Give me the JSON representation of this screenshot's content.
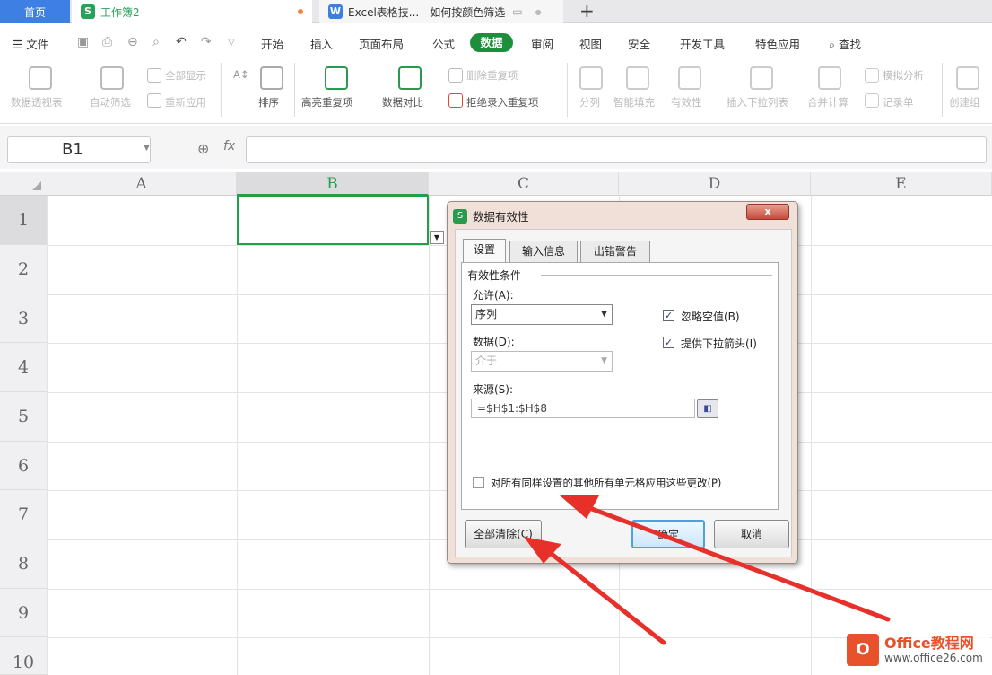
{
  "tabs": {
    "home": "首页",
    "workbook": "工作簿2",
    "doc": "Excel表格技...—如何按颜色筛选",
    "doc_icon": "W",
    "book_icon": "S",
    "new_tab": "+"
  },
  "menu": {
    "file": "文件",
    "items": [
      "开始",
      "插入",
      "页面布局",
      "公式",
      "数据",
      "审阅",
      "视图",
      "安全",
      "开发工具",
      "特色应用"
    ],
    "search": "查找"
  },
  "ribbon": {
    "pivot": "数据透视表",
    "autofilter": "自动筛选",
    "show_all": "全部显示",
    "reapply": "重新应用",
    "sort": "排序",
    "highlight_dup": "高亮重复项",
    "compare": "数据对比",
    "delete_dup": "删除重复项",
    "reject_dup": "拒绝录入重复项",
    "split": "分列",
    "fill": "智能填充",
    "validity": "有效性",
    "dropdown_list": "插入下拉列表",
    "consolidate": "合并计算",
    "simulation": "模拟分析",
    "record": "记录单",
    "create_group": "创建组"
  },
  "formula_bar": {
    "name_box": "B1",
    "fx": "fx",
    "value": ""
  },
  "sheet": {
    "columns": [
      "A",
      "B",
      "C",
      "D",
      "E"
    ],
    "rows": [
      "1",
      "2",
      "3",
      "4",
      "5",
      "6",
      "7",
      "8",
      "9",
      "10"
    ],
    "selected_cell": "B1",
    "accent": "#20a04a"
  },
  "dialog": {
    "title": "数据有效性",
    "close": "x",
    "tabs": [
      "设置",
      "输入信息",
      "出错警告"
    ],
    "criteria_heading": "有效性条件",
    "allow_label": "允许(A):",
    "allow_value": "序列",
    "data_label": "数据(D):",
    "data_value": "介于",
    "ignore_blank": "忽略空值(B)",
    "ignore_blank_checked": true,
    "dropdown_arrow": "提供下拉箭头(I)",
    "dropdown_arrow_checked": true,
    "source_label": "来源(S):",
    "source_value": "=$H$1:$H$8",
    "apply_all": "对所有同样设置的其他所有单元格应用这些更改(P)",
    "apply_all_checked": false,
    "clear_all": "全部清除(C)",
    "ok": "确定",
    "cancel": "取消"
  },
  "watermark": {
    "name": "Office教程网",
    "url": "www.office26.com"
  },
  "annotation_color": "#e8302a"
}
